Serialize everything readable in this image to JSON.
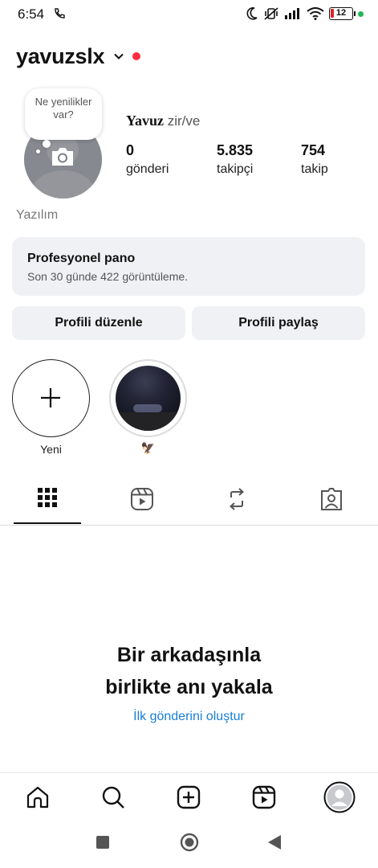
{
  "status_bar": {
    "time": "6:54",
    "battery": "12"
  },
  "header": {
    "username": "yavuzslx"
  },
  "profile": {
    "bubble_text": "Ne yenilikler var?",
    "display_name_bold": "Yavuz",
    "display_name_rest": " zir/ve",
    "stats": [
      {
        "value": "0",
        "label": "gönderi"
      },
      {
        "value": "5.835",
        "label": "takipçi"
      },
      {
        "value": "754",
        "label": "takip"
      }
    ],
    "bio": "Yazılım"
  },
  "pro_dashboard": {
    "title": "Profesyonel pano",
    "subtitle": "Son 30 günde 422 görüntüleme."
  },
  "buttons": {
    "edit_profile": "Profili düzenle",
    "share_profile": "Profili paylaş"
  },
  "stories": {
    "new_label": "Yeni",
    "highlight_label": "🦅"
  },
  "empty_state": {
    "title_line1": "Bir arkadaşınla",
    "title_line2": "birlikte anı yakala",
    "link": "İlk gönderini oluştur"
  },
  "colors": {
    "accent_link": "#1a7ed6",
    "notification_dot": "#ff2d3f",
    "card_bg": "#eff1f4"
  }
}
